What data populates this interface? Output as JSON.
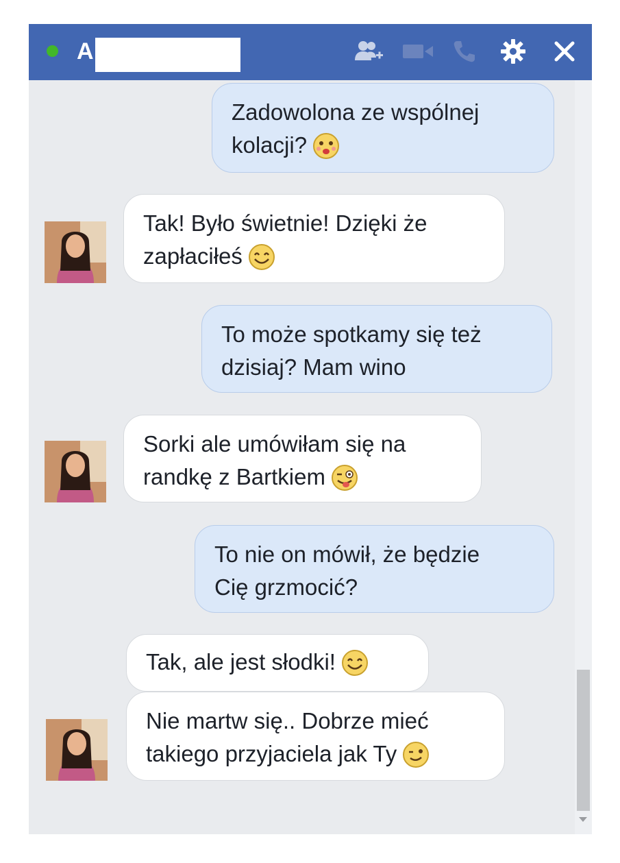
{
  "header": {
    "contact_name_visible": "A",
    "status": "online",
    "icons": [
      "add-friend-icon",
      "video-call-icon",
      "phone-icon",
      "gear-icon",
      "close-icon"
    ]
  },
  "messages": [
    {
      "direction": "outgoing",
      "lines": [
        "Zadowolona ze wspólnej",
        "kolacji?"
      ],
      "emoji": "face-kiss-emoji"
    },
    {
      "direction": "incoming",
      "lines": [
        "Tak! Było świetnie! Dzięki że",
        "zapłaciłeś"
      ],
      "emoji": "smile-emoji"
    },
    {
      "direction": "outgoing",
      "lines": [
        "To może spotkamy się też",
        "dzisiaj? Mam wino"
      ],
      "emoji": null
    },
    {
      "direction": "incoming",
      "lines": [
        "Sorki ale umówiłam się na",
        "randkę z Bartkiem"
      ],
      "emoji": "wink-tongue-emoji"
    },
    {
      "direction": "outgoing",
      "lines": [
        "To nie on mówił, że będzie",
        "Cię grzmocić?"
      ],
      "emoji": null
    },
    {
      "direction": "incoming",
      "lines": [
        "Tak, ale jest słodki!"
      ],
      "emoji": "smile-emoji"
    },
    {
      "direction": "incoming",
      "lines": [
        "Nie martw się.. Dobrze mieć",
        "takiego przyjaciela jak Ty"
      ],
      "emoji": "wink-emoji"
    }
  ],
  "colors": {
    "header": "#4267b2",
    "outgoing_bubble": "#dbe8f9",
    "incoming_bubble": "#ffffff",
    "background": "#e9ebee",
    "online": "#42b72a"
  }
}
